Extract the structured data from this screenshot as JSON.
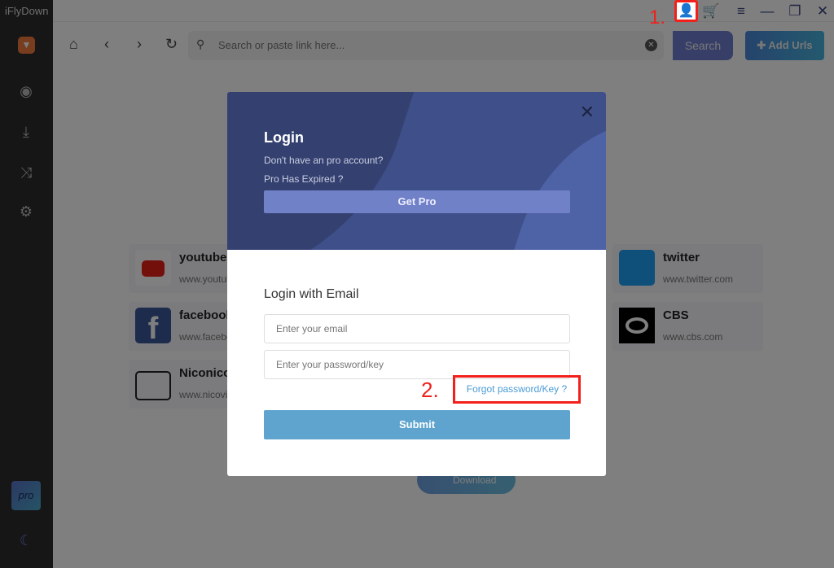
{
  "app": {
    "title": "iFlyDown"
  },
  "toolbar": {
    "search_placeholder": "Search or paste link here...",
    "search_label": "Search",
    "add_urls_label": "Add Urls"
  },
  "sites": [
    {
      "name": "youtube",
      "url": "www.youtube.com",
      "color": "#e62117"
    },
    {
      "name": "facebook",
      "url": "www.facebook.com",
      "color": "#3b5998"
    },
    {
      "name": "Niconico",
      "url": "www.nicovideo.jp",
      "color": "#ffffff"
    },
    {
      "name": "twitter",
      "url": "www.twitter.com",
      "color": "#1da1f2"
    },
    {
      "name": "CBS",
      "url": "www.cbs.com",
      "color": "#000000"
    }
  ],
  "download_label": "Download",
  "sidebar": {
    "pro_label": "pro"
  },
  "modal": {
    "title": "Login",
    "subtitle1": "Don't have an pro account?",
    "subtitle2": "Pro Has Expired ?",
    "get_pro": "Get Pro",
    "section_title": "Login with Email",
    "email_placeholder": "Enter your email",
    "password_placeholder": "Enter your password/key",
    "forgot": "Forgot password/Key ?",
    "submit": "Submit"
  },
  "annotations": {
    "step1": "1.",
    "step2": "2.",
    "color": "#f2201a"
  }
}
